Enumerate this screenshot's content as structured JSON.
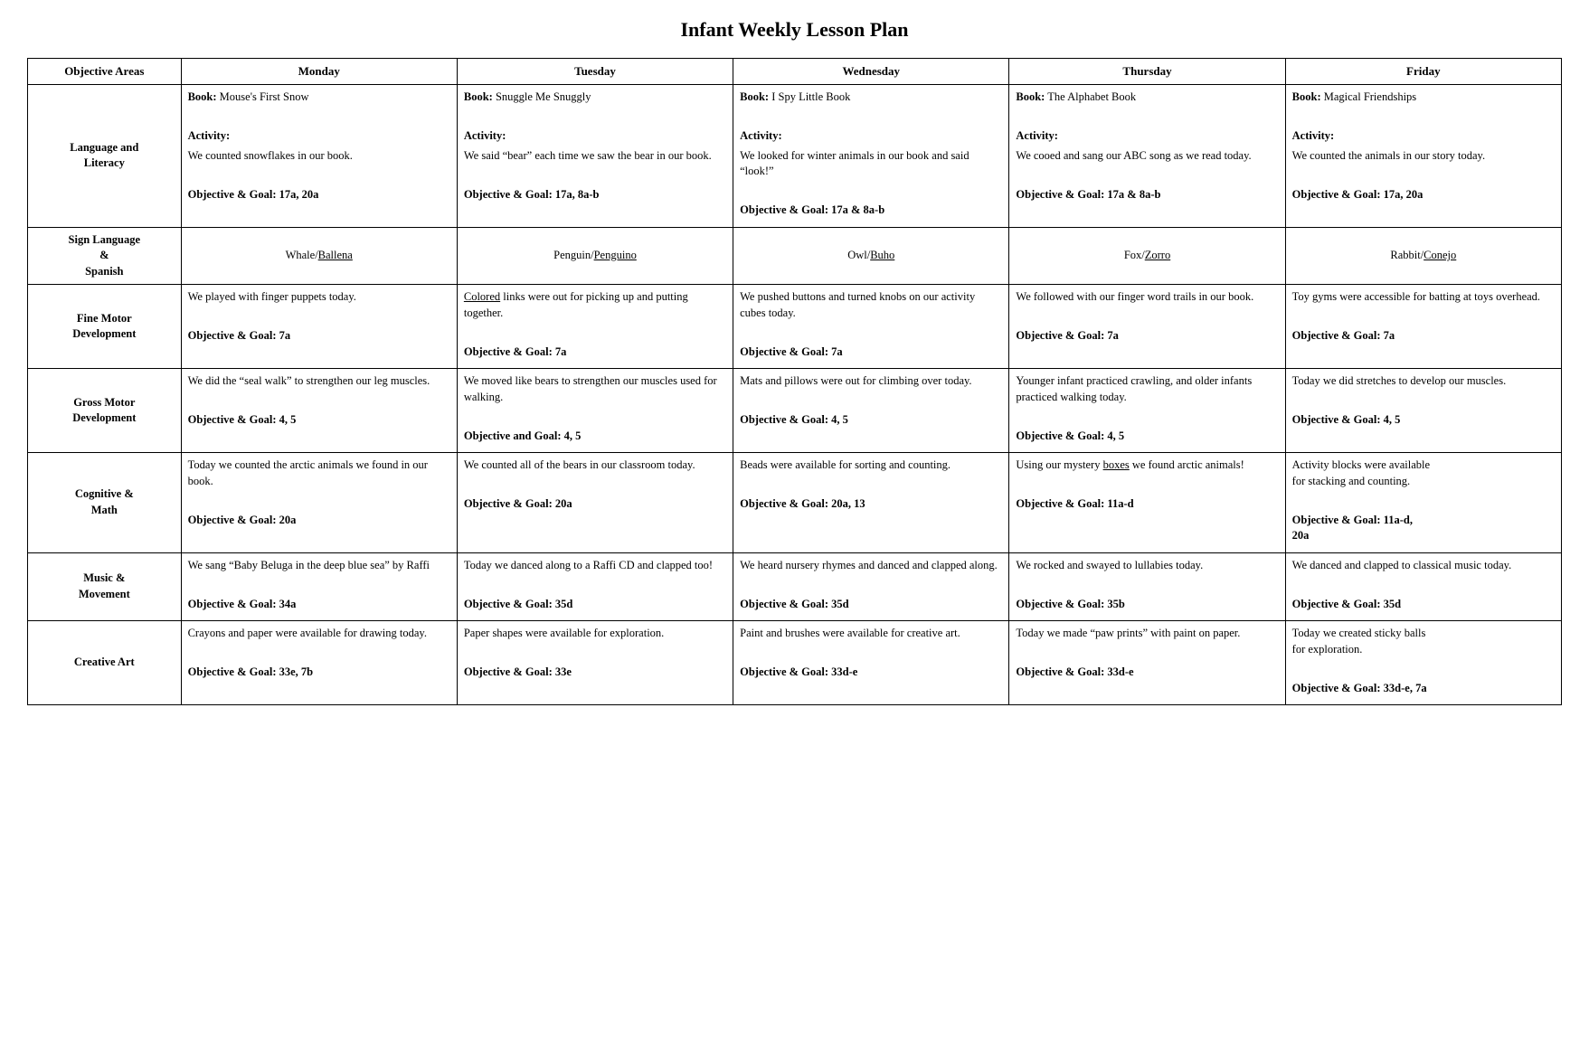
{
  "title": "Infant Weekly Lesson Plan",
  "headers": {
    "area": "Objective Areas",
    "monday": "Monday",
    "tuesday": "Tuesday",
    "wednesday": "Wednesday",
    "thursday": "Thursday",
    "friday": "Friday"
  },
  "rows": [
    {
      "area": "Language and\nLiteracy",
      "monday": {
        "book": "Mouse's First Snow",
        "activity_label": "Activity:",
        "activity": "We counted snowflakes in our book.",
        "objective": "Objective & Goal: 17a, 20a"
      },
      "tuesday": {
        "book": "Snuggle Me Snuggly",
        "activity_label": "Activity:",
        "activity": "We said “bear” each time we saw the bear in our book.",
        "objective": "Objective & Goal: 17a, 8a-b"
      },
      "wednesday": {
        "book": "I Spy Little Book",
        "activity_label": "Activity:",
        "activity": "We looked for winter animals in our book and said “look!”",
        "objective": "Objective & Goal: 17a & 8a-b"
      },
      "thursday": {
        "book": "The Alphabet Book",
        "activity_label": "Activity:",
        "activity": "We cooed and sang our ABC song as we read today.",
        "objective": "Objective & Goal: 17a & 8a-b"
      },
      "friday": {
        "book": "Magical Friendships",
        "activity_label": "Activity:",
        "activity": "We counted the animals in our story today.",
        "objective": "Objective & Goal: 17a, 20a"
      }
    },
    {
      "area": "Sign Language\n&\nSpanish",
      "monday": "Whale/Ballena",
      "tuesday": "Penguin/Penguino",
      "wednesday": "Owl/Buho",
      "thursday": "Fox/Zorro",
      "friday": "Rabbit/Conejo",
      "type": "sign"
    },
    {
      "area": "Fine Motor\nDevelopment",
      "monday": {
        "text": "We played with finger puppets today.",
        "objective": "Objective & Goal: 7a"
      },
      "tuesday": {
        "text": "Colored links were out for picking up and putting together.",
        "objective": "Objective & Goal: 7a",
        "tuesday_underline": "Colored"
      },
      "wednesday": {
        "text": "We pushed buttons and turned knobs on our activity cubes today.",
        "objective": "Objective & Goal: 7a"
      },
      "thursday": {
        "text": "We followed with our finger word trails in our book.",
        "objective": "Objective & Goal: 7a"
      },
      "friday": {
        "text": "Toy gyms were accessible for batting at toys overhead.",
        "objective": "Objective & Goal: 7a"
      }
    },
    {
      "area": "Gross Motor\nDevelopment",
      "monday": {
        "text": "We did the “seal walk” to strengthen our leg muscles.",
        "objective": "Objective & Goal: 4, 5"
      },
      "tuesday": {
        "text": "We moved like bears to strengthen our muscles used for walking.",
        "objective": "Objective and Goal: 4, 5"
      },
      "wednesday": {
        "text": "Mats and pillows were out for climbing over today.",
        "objective": "Objective & Goal: 4, 5"
      },
      "thursday": {
        "text": "Younger infant practiced crawling, and older infants practiced walking today.",
        "objective": "Objective & Goal: 4, 5"
      },
      "friday": {
        "text": "Today we did stretches to develop our muscles.",
        "objective": "Objective & Goal: 4, 5"
      }
    },
    {
      "area": "Cognitive &\nMath",
      "monday": {
        "text": "Today we counted the arctic animals we found in our book.",
        "objective": "Objective & Goal: 20a"
      },
      "tuesday": {
        "text": "We counted all of the bears in our classroom today.",
        "objective": "Objective & Goal: 20a"
      },
      "wednesday": {
        "text": "Beads were available for sorting and counting.",
        "objective": "Objective & Goal: 20a, 13"
      },
      "thursday": {
        "text": "Using our mystery boxes we found arctic animals!",
        "objective": "Objective & Goal: 11a-d",
        "thursday_underline": "boxes"
      },
      "friday": {
        "text": "Activity blocks were available\nfor stacking and counting.",
        "objective": "Objective & Goal: 11a-d,\n20a"
      }
    },
    {
      "area": "Music &\nMovement",
      "monday": {
        "text": "We sang “Baby Beluga in the deep blue sea” by Raffi",
        "objective": "Objective & Goal: 34a"
      },
      "tuesday": {
        "text": "Today we danced along to a Raffi CD and clapped too!",
        "objective": "Objective & Goal: 35d"
      },
      "wednesday": {
        "text": "We heard nursery rhymes and danced and clapped along.",
        "objective": "Objective & Goal: 35d"
      },
      "thursday": {
        "text": "We rocked and swayed to lullabies today.",
        "objective": "Objective & Goal: 35b"
      },
      "friday": {
        "text": "We danced and clapped to classical music today.",
        "objective": "Objective & Goal: 35d"
      }
    },
    {
      "area": "Creative Art",
      "monday": {
        "text": "Crayons and paper were available for drawing today.",
        "objective": "Objective & Goal: 33e, 7b"
      },
      "tuesday": {
        "text": "Paper shapes were available for exploration.",
        "objective": "Objective & Goal: 33e"
      },
      "wednesday": {
        "text": "Paint and brushes were available for creative art.",
        "objective": "Objective & Goal: 33d-e"
      },
      "thursday": {
        "text": "Today we made “paw prints” with paint on paper.",
        "objective": "Objective & Goal: 33d-e"
      },
      "friday": {
        "text": "Today we created sticky balls\nfor exploration.",
        "objective": "Objective & Goal: 33d-e, 7a"
      }
    }
  ]
}
